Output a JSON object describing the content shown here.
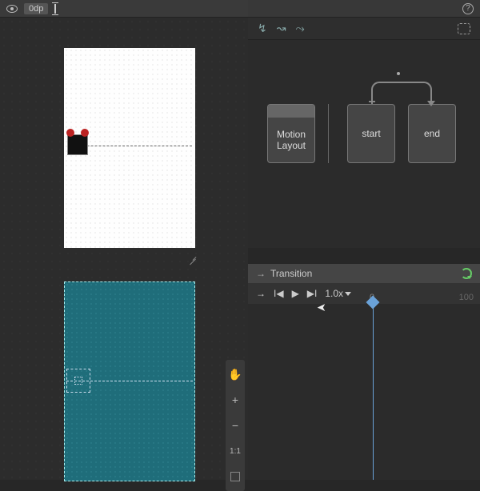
{
  "toolbar_left": {
    "dp_label": "0dp"
  },
  "motion_graph": {
    "layout_label_line1": "Motion",
    "layout_label_line2": "Layout",
    "start_label": "start",
    "end_label": "end"
  },
  "transition_panel": {
    "title": "Transition",
    "speed_label": "1.0x"
  },
  "timeline": {
    "start_tick": "0",
    "end_tick": "100"
  },
  "zoom_toolbar": {
    "pan_icon": "✋",
    "zoom_in": "+",
    "zoom_out": "−",
    "one_to_one": "1:1"
  },
  "help": "?"
}
